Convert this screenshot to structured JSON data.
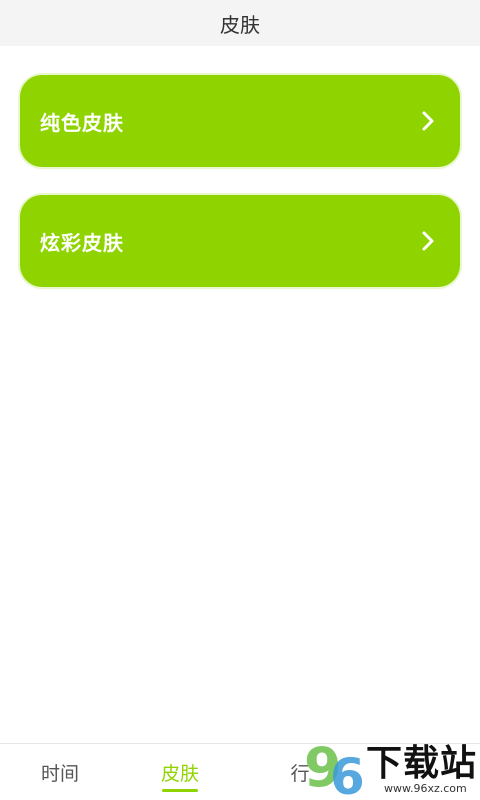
{
  "header": {
    "title": "皮肤"
  },
  "options": [
    {
      "label": "纯色皮肤",
      "icon": "chevron-right-icon"
    },
    {
      "label": "炫彩皮肤",
      "icon": "chevron-right-icon"
    }
  ],
  "bottom_nav": {
    "items": [
      {
        "label": "时间",
        "active": false
      },
      {
        "label": "皮肤",
        "active": true
      },
      {
        "label": "行",
        "active": false
      }
    ]
  },
  "watermark": {
    "logo_text": "96",
    "text": "下载站",
    "url": "www.96xz.com"
  },
  "colors": {
    "accent": "#8fd400",
    "header_bg": "#f4f4f4",
    "text": "#333333"
  }
}
